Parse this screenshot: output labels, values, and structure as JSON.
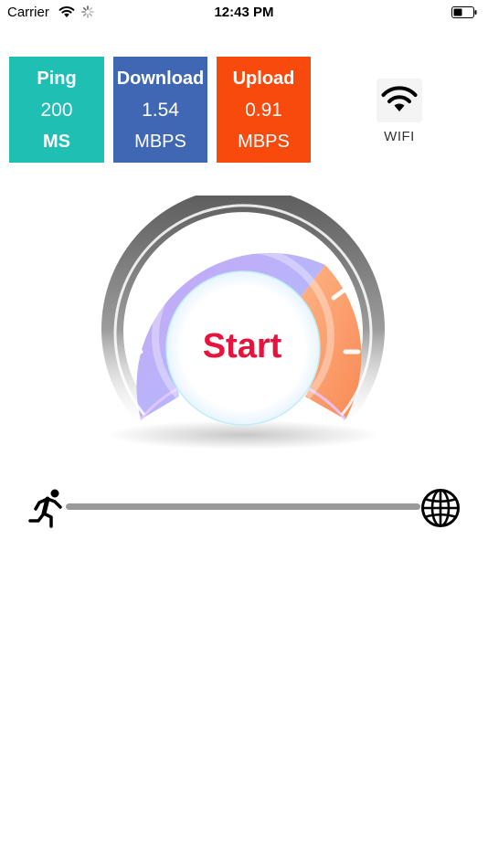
{
  "status_bar": {
    "carrier": "Carrier",
    "time": "12:43 PM",
    "icons": [
      "wifi-icon",
      "activity-spinner-icon",
      "battery-icon"
    ]
  },
  "stats": {
    "ping": {
      "title": "Ping",
      "value": "200",
      "unit": "MS",
      "color": "#1fbfb3"
    },
    "download": {
      "title": "Download",
      "value": "1.54",
      "unit": "MBPS",
      "color": "#3f67b4"
    },
    "upload": {
      "title": "Upload",
      "value": "0.91",
      "unit": "MBPS",
      "color": "#f74a0c"
    }
  },
  "network": {
    "label": "WIFI",
    "icon": "wifi-icon"
  },
  "gauge": {
    "button_label": "Start",
    "accent": "#e8123c"
  },
  "progress": {
    "value": 0,
    "start_icon": "runner-icon",
    "end_icon": "globe-icon"
  }
}
